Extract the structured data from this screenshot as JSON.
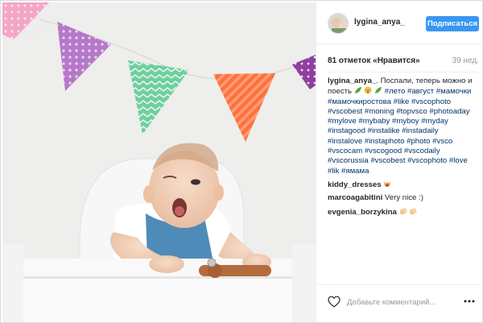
{
  "post": {
    "username": "lygina_anya_",
    "follow_label": "Подписаться",
    "likes": "81 отметок «Нравится»",
    "time": "39 нед."
  },
  "caption": {
    "username": "lygina_anya_",
    "text_lines": [
      "Поспали, теперь можно и",
      "поесть",
      "#лето #август #мамочки",
      "#мамочкиростова #like #vscophoto",
      "#vscobest #moning #topvsco #photoaday",
      "#mylove #mybaby #myboy #myday",
      "#instagood #instalike #instadaily",
      "#instalove #instaphoto #photo #vsco",
      "#vscocam #vscogood #vscodaily",
      "#vscorussia #vscobest #vscophoto #love",
      "#lik #ямама"
    ]
  },
  "comments": [
    {
      "user": "kiddy_dresses",
      "text": ""
    },
    {
      "user": "marcoagabitini",
      "text": "Very nice :)"
    },
    {
      "user": "evgenia_borzykina",
      "text": ""
    }
  ],
  "actions": {
    "add_comment_placeholder": "Добавьте комментарий..."
  },
  "icons": {
    "like": "heart-outline-icon",
    "more": "more-dots-icon"
  },
  "colors": {
    "follow_button": "#3897f0",
    "hashtag": "#003569",
    "muted": "#999999"
  }
}
